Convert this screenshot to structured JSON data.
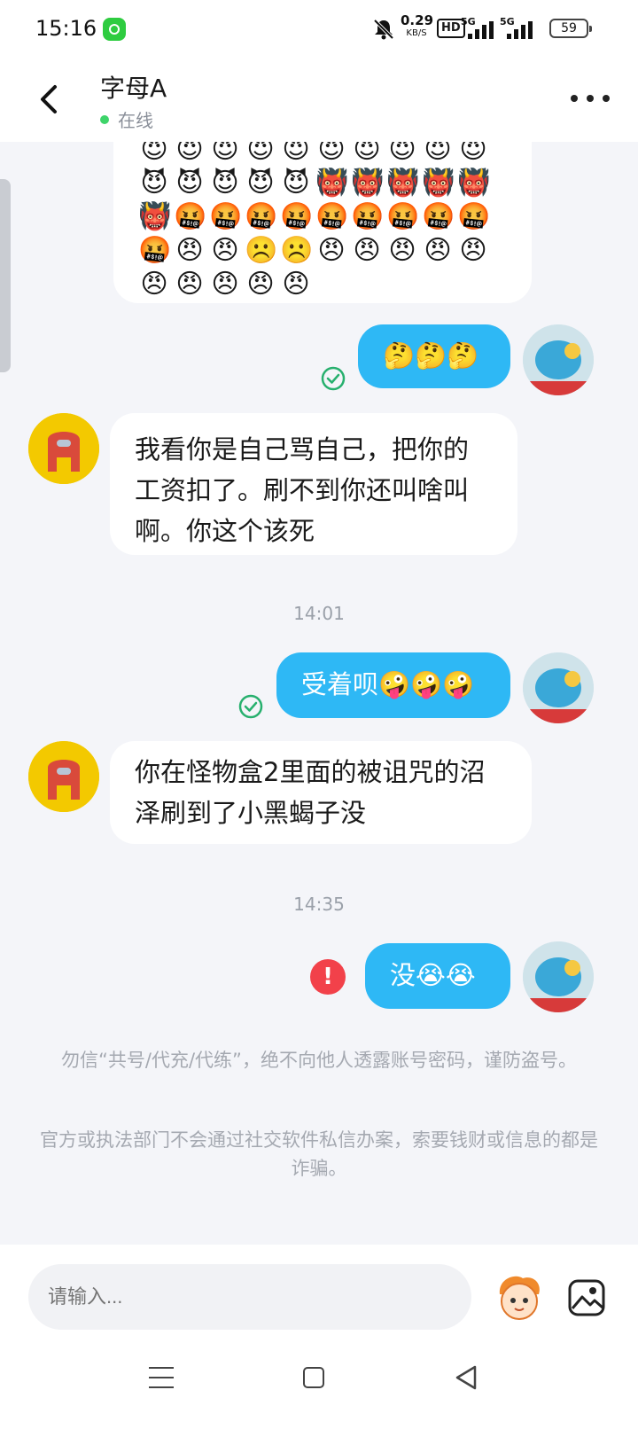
{
  "status_bar": {
    "time": "15:16",
    "net_speed_value": "0.29",
    "net_speed_unit": "KB/S",
    "hd_badge": "HD",
    "sim1_label": "5G",
    "sim2_label": "5G",
    "battery": "59"
  },
  "header": {
    "title": "字母A",
    "status": "在线",
    "status_color": "#3ed46a"
  },
  "chat": {
    "sticker_rows": [
      "😈😈😈😈😈😈😈😈😈😈",
      "😈😈😈😈😈👹👹👹👹👹",
      "👹🤬🤬🤬🤬🤬🤬🤬🤬🤬",
      "🤬😠😠☹️☹️😠😠😠😠😠",
      "😠😠😠😠😠"
    ],
    "messages": [
      {
        "side": "out",
        "text": "🤔🤔🤔",
        "status": "sent"
      },
      {
        "side": "in",
        "text": "我看你是自己骂自己，把你的工资扣了。刷不到你还叫啥叫啊。你这个该死"
      },
      {
        "side": "time",
        "text": "14:01"
      },
      {
        "side": "out",
        "text": "受着呗🤪🤪🤪",
        "status": "sent"
      },
      {
        "side": "in",
        "text": "你在怪物盒2里面的被诅咒的沼泽刷到了小黑蝎子没"
      },
      {
        "side": "time",
        "text": "14:35"
      },
      {
        "side": "out",
        "text": "没😭😭",
        "status": "failed",
        "failed_icon": "!"
      }
    ],
    "notices": [
      "勿信“共号/代充/代练”，绝不向他人透露账号密码，谨防盗号。",
      "官方或执法部门不会通过社交软件私信办案，索要钱财或信息的都是诈骗。"
    ],
    "accent_color": "#2eb8f5"
  },
  "input": {
    "placeholder": "请输入..."
  },
  "icons": [
    "back-arrow-icon",
    "more-icon",
    "check-circle-icon",
    "error-icon",
    "mascot-sticker-icon",
    "image-icon"
  ]
}
